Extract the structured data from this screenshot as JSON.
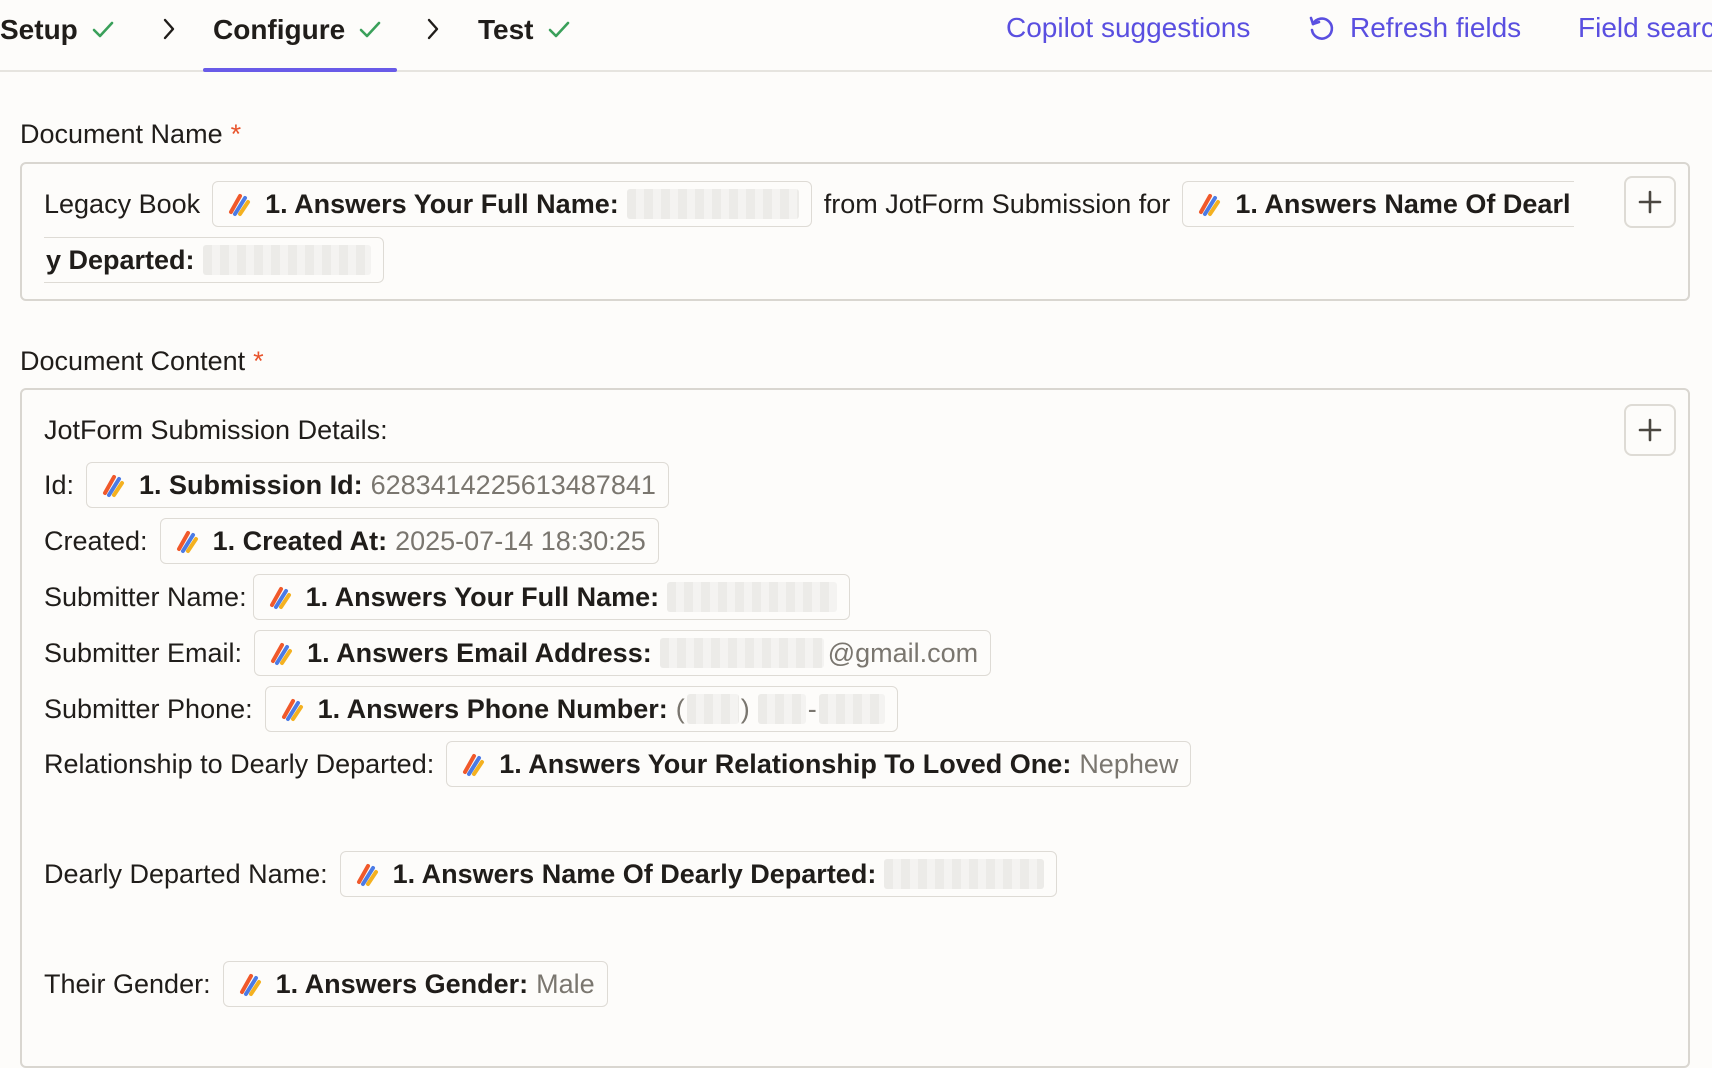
{
  "breadcrumb": {
    "steps": [
      {
        "label": "Setup",
        "complete": true
      },
      {
        "label": "Configure",
        "complete": true,
        "active": true
      },
      {
        "label": "Test",
        "complete": true
      }
    ]
  },
  "toolbar": {
    "copilot_label": "Copilot suggestions",
    "refresh_label": "Refresh fields",
    "field_search_label": "Field searc"
  },
  "colors": {
    "accent": "#695be8",
    "link": "#5a4fe0",
    "check": "#3aa05a",
    "required": "#e8542c"
  },
  "document_name": {
    "label": "Document Name",
    "required_mark": "*",
    "prefix": "Legacy Book",
    "pill1_name": "1. Answers Your Full Name:",
    "middle_text": "from JotForm Submission for",
    "pill2_name": "1. Answers Name Of Dearl",
    "pill2_cont": "y Departed:"
  },
  "document_content": {
    "label": "Document Content",
    "required_mark": "*",
    "heading": "JotForm Submission Details:",
    "rows": [
      {
        "label": "Id:",
        "field": "1. Submission Id:",
        "value": "6283414225613487841"
      },
      {
        "label": "Created:",
        "field": "1. Created At:",
        "value": "2025-07-14 18:30:25"
      },
      {
        "label": "Submitter Name:",
        "field": "1. Answers Your Full Name:",
        "value": ""
      },
      {
        "label": "Submitter Email:",
        "field": "1. Answers Email Address:",
        "value": "@gmail.com"
      },
      {
        "label": "Submitter Phone:",
        "field": "1. Answers Phone Number:",
        "value_prefix": "(",
        "value_mid": ")",
        "value_dash": "-"
      },
      {
        "label": "Relationship to Dearly Departed:",
        "field": "1. Answers Your Relationship To Loved One:",
        "value": "Nephew"
      },
      {
        "label": "Dearly Departed Name:",
        "field": "1. Answers Name Of Dearly Departed:",
        "value": ""
      },
      {
        "label": "Their Gender:",
        "field": "1. Answers Gender:",
        "value": "Male"
      }
    ]
  },
  "icons": {
    "step_complete": "check-icon",
    "step_separator": "chevron-right-icon",
    "refresh": "refresh-icon",
    "add": "plus-icon",
    "field_source": "zapier-app-icon"
  }
}
